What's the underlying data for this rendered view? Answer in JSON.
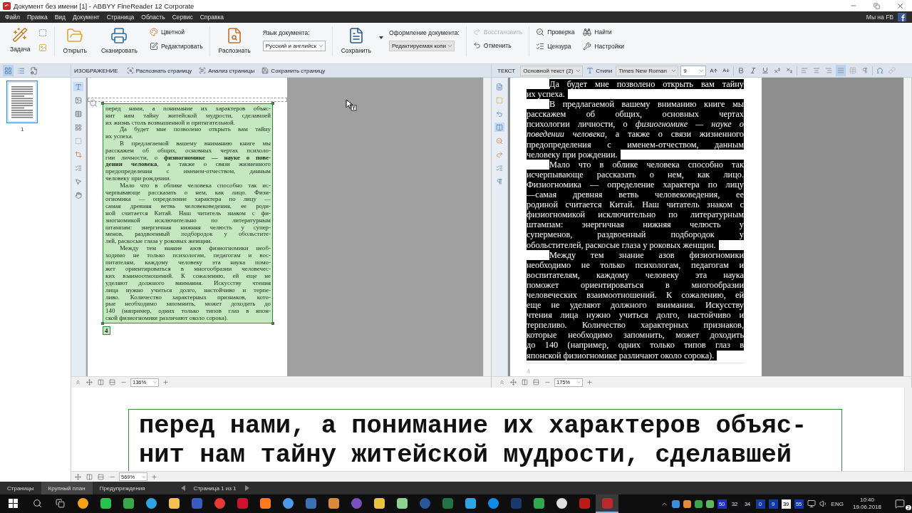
{
  "window": {
    "title": "Документ без имени [1] - ABBYY FineReader 12 Corporate"
  },
  "menu": [
    "Файл",
    "Правка",
    "Вид",
    "Документ",
    "Страница",
    "Область",
    "Сервис",
    "Справка"
  ],
  "menu_right": {
    "label": "Мы на FB"
  },
  "ribbon": {
    "task": "Задача",
    "open": "Открыть",
    "scan": "Сканировать",
    "color_mode": "Цветной",
    "edit": "Редактировать",
    "recognize": "Распознать",
    "language": {
      "label": "Язык документа:",
      "value": "Русский и английск"
    },
    "save": "Сохранить",
    "layout": {
      "label": "Оформление документа:",
      "value": "Редактируемая копи"
    },
    "redo": {
      "label": "Восстановить",
      "disabled": true
    },
    "undo": {
      "label": "Отменить",
      "disabled": false
    },
    "verify": "Проверка",
    "find": "Найти",
    "censor": "Цензура",
    "settings": "Настройки"
  },
  "pages_panel": {
    "view_modes": [
      {
        "kind": "thumbnails",
        "selected": true
      },
      {
        "kind": "details",
        "selected": false
      }
    ],
    "thumbnails": [
      {
        "label": "1",
        "selected": true
      }
    ]
  },
  "image_pane": {
    "header": "ИЗОБРАЖЕНИЕ",
    "actions": [
      "Распознать страницу",
      "Анализ страницы",
      "Сохранить страницу"
    ],
    "zoom": "136%",
    "page_number": "4",
    "paragraphs": [
      {
        "continued": true,
        "lines": [
          "перед нами, а понимание их характеров объяс-",
          "нит нам тайну житейской мудрости, сделавшей",
          "их жизнь столь возвышенной и притягательной."
        ]
      },
      {
        "continued": false,
        "lines": [
          "Да будет мне позволено открыть вам тайну",
          "их успеха."
        ]
      },
      {
        "continued": false,
        "lines": [
          "В предлагаемой вашему вниманию книге мы",
          "расскажем об общих, основных чертах психоло-",
          "гии личности, о **физиогномике — науке о пове-**",
          "**дении человека**, а также о связи жизненного",
          "предопределения с именем-отчеством, данным",
          "человеку при рождении."
        ]
      },
      {
        "continued": false,
        "lines": [
          "Мало что в облике человека способно так ис-",
          "черпывающе рассказать о нем, как лицо. Физи-",
          "огномика — определение характера по лицу —",
          "самая древняя ветвь человековедения, ее роди-",
          "ной считается Китай. Наш читатель знаком с фи-",
          "зиогномикой исключительно по литературным",
          "штампам: энергичная нижняя челюсть у супер-",
          "менов, раздвоенный подбородок у обольстите-",
          "лей, раскосые глаза у роковых женщин."
        ]
      },
      {
        "continued": false,
        "lines": [
          "Между тем знание азов физиогномики необ-",
          "ходимо не только психологам, педагогам и вос-",
          "питателям, каждому человеку эта наука помо-",
          "жет ориентироваться в многообразии человечес-",
          "ких взаимоотношений. К сожалению, ей еще не",
          "уделяют должного внимания. Искусству чтения",
          "лица нужно учиться долго, настойчиво и терпе-",
          "ливо. Количество характерных признаков, кото-",
          "рые необходимо запомнить, может доходить до",
          "140 (например, одних только типов глаз в япон-",
          "ской физиогномике различают около сорока)."
        ]
      }
    ]
  },
  "text_pane": {
    "header": "ТЕКСТ",
    "style": "Основной текст (2)",
    "styles_button": "Стили",
    "font": "Times New Roman",
    "size": "9",
    "alignments": [
      {
        "kind": "left",
        "selected": false
      },
      {
        "kind": "center",
        "selected": false
      },
      {
        "kind": "right",
        "selected": false
      },
      {
        "kind": "justify",
        "selected": true
      }
    ],
    "zoom": "175%",
    "page_number": "4",
    "paragraphs": [
      {
        "lines": [
          "Да будет мне позволено открыть вам тайну",
          "их успеха."
        ]
      },
      {
        "lines": [
          "В предлагаемой вашему вниманию книге мы",
          "расскажем об общих, основных чертах",
          "психологии личности, о *физиогномике — науке о*",
          "*поведении человека,* а также о связи жизненного",
          "предопределения с именем-отчеством, данным",
          "человеку при рождении."
        ]
      },
      {
        "lines": [
          "Мало что в облике человека способно так",
          "исчерпывающе рассказать о нем, как лицо.",
          "Физиогномика — определение характера по лицу",
          "—самая древняя ветвь человековедения, ее",
          "родиной считается Китай. Наш читатель знаком с",
          "физиогномикой исключительно по литературным",
          "штампам: энергичная нижняя челюсть у",
          "суперменов, раздвоенный подбородок у",
          "обольстителей, раскосые глаза у роковых женщин."
        ]
      },
      {
        "lines": [
          "Между тем знание азов физиогномики",
          "необходимо не только психологам, педагогам и",
          "воспитателям, каждому человеку эта наука",
          "поможет ориентироваться в многообразии",
          "человеческих взаимоотношений. К сожалению, ей",
          "еще не уделяют должного внимания. Искусству",
          "чтения лица нужно учиться долго, настойчиво и",
          "терпеливо. Количество характерных признаков,",
          "которые необходимо запомнить, может доходить",
          "до 140 (например, одних только типов глаз в",
          "японской физиогномике различают около сорока)."
        ]
      }
    ]
  },
  "zoom_pane": {
    "zoom": "569%",
    "lines": [
      "перед нами, а понимание их характеров объяс-",
      "нит нам тайну житейской мудрости, сделавшей"
    ]
  },
  "bottom_tabs": [
    {
      "label": "Страницы",
      "selected": false
    },
    {
      "label": "Крупный план",
      "selected": true
    },
    {
      "label": "Предупреждения",
      "selected": false
    }
  ],
  "page_nav": {
    "label": "Страница 1 из 1"
  },
  "taskbar": {
    "apps": [
      {
        "color": "#f2a31b",
        "selected": false
      },
      {
        "color": "#25c351",
        "selected": false
      },
      {
        "color": "#3aa64c",
        "selected": false
      },
      {
        "color": "#2ca5e0",
        "selected": false
      },
      {
        "color": "#f2c14e",
        "selected": false
      },
      {
        "color": "#3a5bbf",
        "selected": false
      },
      {
        "color": "#e53935",
        "selected": false
      },
      {
        "color": "#d0102c",
        "selected": false
      },
      {
        "color": "#ff7a1a",
        "selected": false
      },
      {
        "color": "#4c9be8",
        "selected": false
      },
      {
        "color": "#3b6fb6",
        "selected": false
      },
      {
        "color": "#d98b3a",
        "selected": false
      },
      {
        "color": "#7a4fc0",
        "selected": false
      },
      {
        "color": "#e8c53a",
        "selected": false
      },
      {
        "color": "#8fd18f",
        "selected": false
      },
      {
        "color": "#2b579a",
        "selected": false
      },
      {
        "color": "#217346",
        "selected": false
      },
      {
        "color": "#2ca5e0",
        "selected": false
      },
      {
        "color": "#0e8ee9",
        "selected": false
      },
      {
        "color": "#1b3a6b",
        "selected": false
      },
      {
        "color": "#2fa84f",
        "selected": false
      },
      {
        "color": "#e0e0e0",
        "selected": false
      },
      {
        "color": "#bf1a1a",
        "selected": false
      },
      {
        "color": "#c0272d",
        "selected": true
      }
    ],
    "tray_counters": [
      {
        "text": "50",
        "color": "#1f2fc4"
      },
      {
        "text": "32",
        "color": "#101010"
      },
      {
        "text": "34",
        "color": "#101010"
      },
      {
        "text": "0",
        "color": "#1438a8"
      },
      {
        "text": "9",
        "color": "#1438a8"
      },
      {
        "text": "39",
        "color": "#f4f4f4"
      },
      {
        "text": "55",
        "color": "#1438a8"
      }
    ],
    "language": "ENG",
    "time": "10:40",
    "date": "19.06.2018",
    "notifications": "2"
  }
}
